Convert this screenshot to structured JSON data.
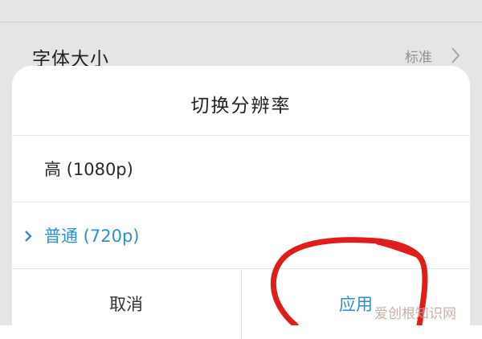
{
  "background": {
    "setting_label": "字体大小",
    "setting_value": "标准",
    "chevron_icon": "chevron-right-icon"
  },
  "dialog": {
    "title": "切换分辨率",
    "options": [
      {
        "label": "高 (1080p)",
        "selected": false
      },
      {
        "label": "普通 (720p)",
        "selected": true
      }
    ],
    "cancel_label": "取消",
    "apply_label": "应用"
  },
  "colors": {
    "accent": "#2a91c7",
    "annotation": "#e01d1d"
  },
  "watermark": "爱创根知识网"
}
